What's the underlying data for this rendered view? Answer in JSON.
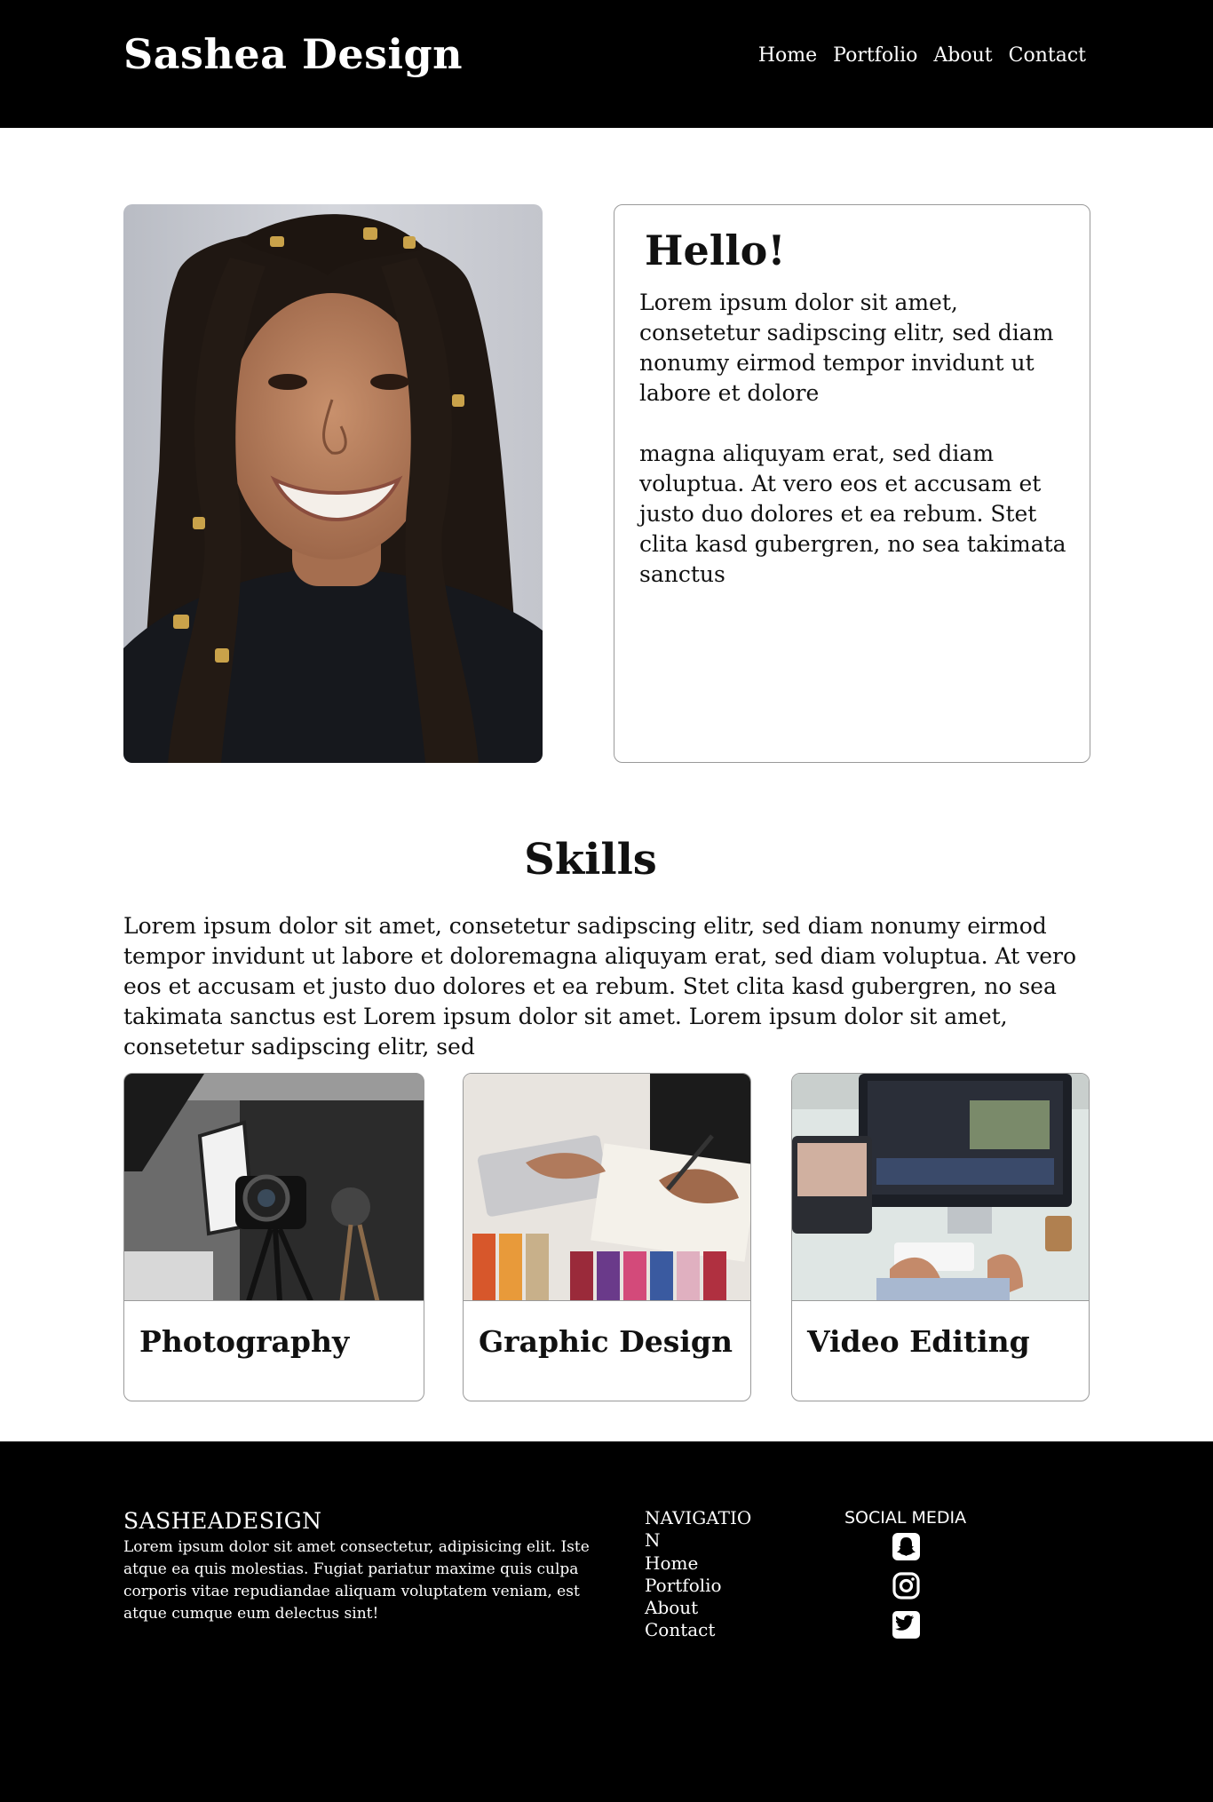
{
  "header": {
    "brand": "Sashea Design",
    "nav": [
      "Home",
      "Portfolio",
      "About",
      "Contact"
    ]
  },
  "intro": {
    "title": "Hello!",
    "paragraph1": "Lorem ipsum dolor sit amet, consetetur sadipscing elitr, sed diam nonumy eirmod tempor invidunt ut labore et dolore",
    "paragraph2": "magna aliquyam erat, sed diam voluptua. At vero eos et accusam et justo duo dolores et ea rebum. Stet clita kasd gubergren, no sea takimata sanctus"
  },
  "skills": {
    "title": "Skills",
    "text": "Lorem ipsum dolor sit amet, consetetur sadipscing elitr, sed diam nonumy eirmod tempor invidunt ut labore et doloremagna aliquyam erat, sed diam voluptua. At vero eos et accusam et justo duo dolores et ea rebum. Stet clita kasd gubergren, no sea takimata sanctus est Lorem ipsum dolor sit amet. Lorem ipsum dolor sit amet, consetetur sadipscing elitr, sed",
    "cards": [
      {
        "label": "Photography"
      },
      {
        "label": "Graphic Design"
      },
      {
        "label": "Video Editing"
      }
    ]
  },
  "footer": {
    "brand": "SASHEADESIGN",
    "about": "Lorem ipsum dolor sit amet consectetur, adipisicing elit. Iste atque ea quis molestias. Fugiat pariatur maxime quis culpa corporis vitae repudiandae aliquam voluptatem veniam, est atque cumque eum delectus sint!",
    "nav_title": "NAVIGATION",
    "nav": [
      "Home",
      "Portfolio",
      "About",
      "Contact"
    ],
    "social_title": "SOCIAL MEDIA",
    "social_icons": [
      "snapchat-icon",
      "instagram-icon",
      "twitter-icon"
    ]
  },
  "colors": {
    "header_bg": "#000000",
    "footer_bg": "#000000",
    "card_border": "#9a9a9a"
  }
}
